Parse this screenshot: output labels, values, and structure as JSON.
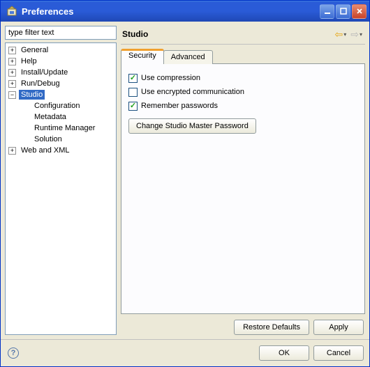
{
  "window": {
    "title": "Preferences"
  },
  "filter": {
    "value": "type filter text"
  },
  "tree": {
    "items": [
      {
        "label": "General",
        "expander": "+",
        "selected": false
      },
      {
        "label": "Help",
        "expander": "+",
        "selected": false
      },
      {
        "label": "Install/Update",
        "expander": "+",
        "selected": false
      },
      {
        "label": "Run/Debug",
        "expander": "+",
        "selected": false
      },
      {
        "label": "Studio",
        "expander": "−",
        "selected": true,
        "children": [
          {
            "label": "Configuration"
          },
          {
            "label": "Metadata"
          },
          {
            "label": "Runtime Manager"
          },
          {
            "label": "Solution"
          }
        ]
      },
      {
        "label": "Web and XML",
        "expander": "+",
        "selected": false
      }
    ]
  },
  "page": {
    "title": "Studio",
    "tabs": [
      {
        "label": "Security",
        "active": true
      },
      {
        "label": "Advanced",
        "active": false
      }
    ],
    "security": {
      "use_compression": {
        "label": "Use compression",
        "checked": true
      },
      "use_encrypted": {
        "label": "Use encrypted communication",
        "checked": false
      },
      "remember_passwords": {
        "label": "Remember passwords",
        "checked": true
      },
      "change_pw_button": "Change Studio Master Password"
    },
    "buttons": {
      "restore": "Restore Defaults",
      "apply": "Apply"
    }
  },
  "dialog_buttons": {
    "ok": "OK",
    "cancel": "Cancel"
  }
}
